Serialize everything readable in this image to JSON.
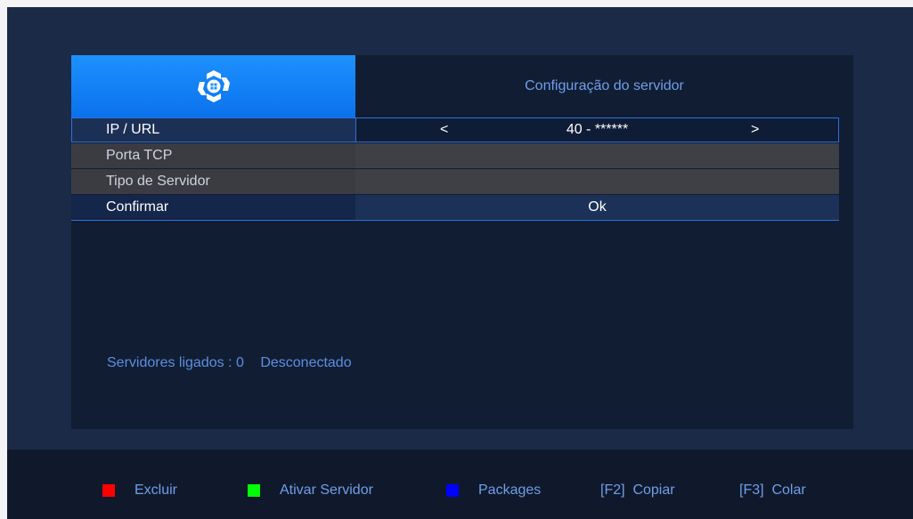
{
  "header": {
    "logo": "satellite-logo-icon",
    "title": "Configuração do servidor",
    "logo_color": "#1e90ff"
  },
  "rows": [
    {
      "label": "IP / URL",
      "arrow_left": "<",
      "value": "40 - ******",
      "arrow_right": ">"
    },
    {
      "label": "Porta TCP",
      "value": ""
    },
    {
      "label": "Tipo de Servidor",
      "value": ""
    },
    {
      "label": "Confirmar",
      "value": "Ok"
    }
  ],
  "status": {
    "connected": "Servidores ligados : 0",
    "state": "Desconectado"
  },
  "footer": {
    "keys": [
      {
        "color": "#ff0000",
        "label": "Excluir"
      },
      {
        "color": "#00ff00",
        "label": "Ativar Servidor"
      },
      {
        "color": "#0000ff",
        "label": "Packages"
      },
      {
        "label": "[F2]  Copiar"
      },
      {
        "label": "[F3]  Colar"
      }
    ]
  }
}
